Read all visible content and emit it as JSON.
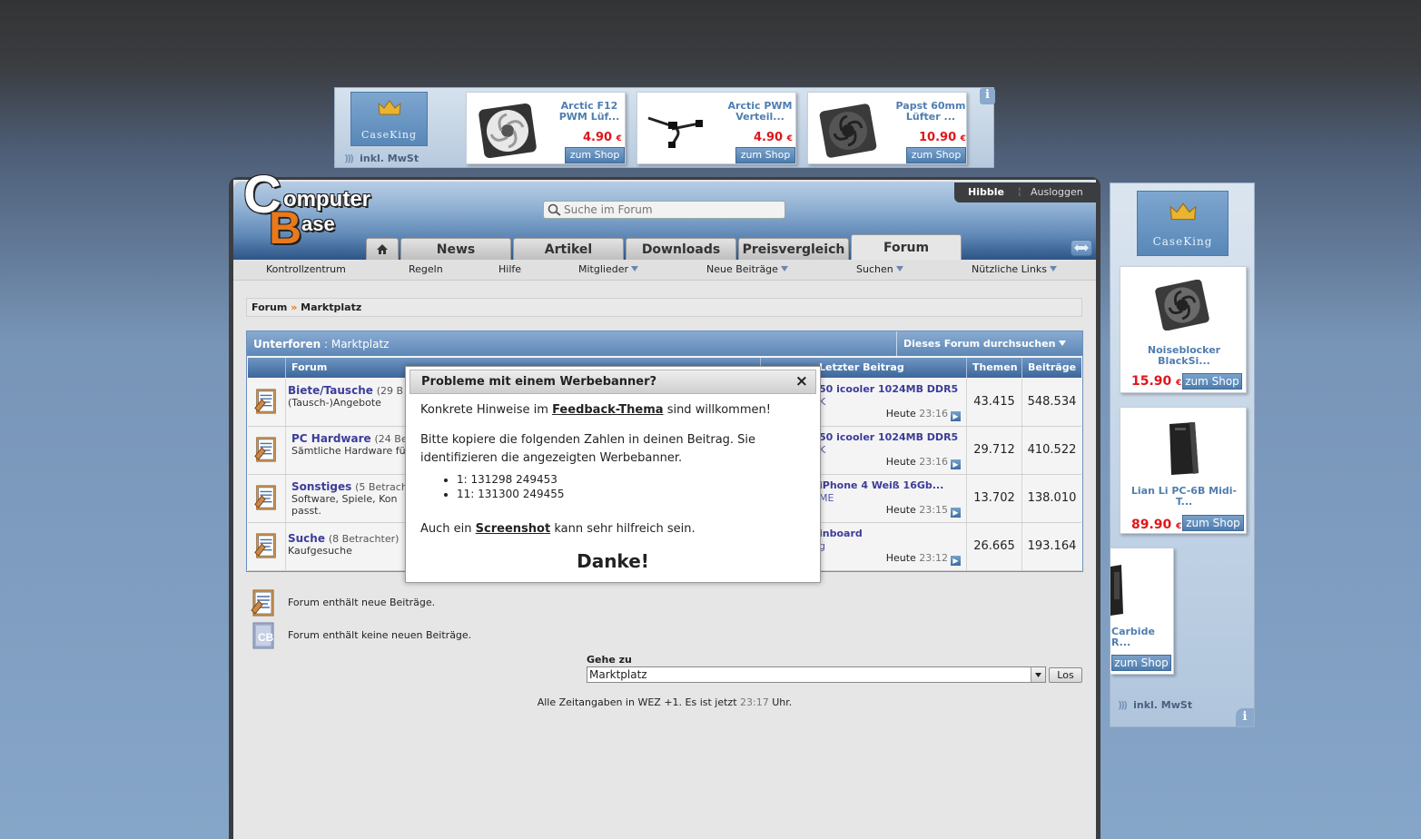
{
  "top_ad": {
    "brand": "CaseKing",
    "mwst": "inkl. MwSt",
    "info": "i",
    "products": [
      {
        "name": "Arctic F12 PWM Lüf...",
        "price": "4.90",
        "currency": "€",
        "button": "zum Shop",
        "icon": "fan-white-icon"
      },
      {
        "name": "Arctic PWM Verteil...",
        "price": "4.90",
        "currency": "€",
        "button": "zum Shop",
        "icon": "cable-icon"
      },
      {
        "name": "Papst 60mm Lüfter ...",
        "price": "10.90",
        "currency": "€",
        "button": "zum Shop",
        "icon": "fan-black-icon"
      }
    ]
  },
  "header": {
    "logo_line1": "omputer",
    "logo_line2": "ase",
    "logo_c": "C",
    "logo_b": "B",
    "search_placeholder": "Suche im Forum",
    "user": "Hibble",
    "logout": "Ausloggen"
  },
  "tabs": [
    {
      "label": "News"
    },
    {
      "label": "Artikel"
    },
    {
      "label": "Downloads"
    },
    {
      "label": "Preisvergleich"
    },
    {
      "label": "Forum"
    }
  ],
  "subnav": [
    {
      "label": "Kontrollzentrum"
    },
    {
      "label": "Regeln"
    },
    {
      "label": "Hilfe"
    },
    {
      "label": "Mitglieder"
    },
    {
      "label": "Neue Beiträge"
    },
    {
      "label": "Suchen"
    },
    {
      "label": "Nützliche Links"
    }
  ],
  "breadcrumb": {
    "root": "Forum",
    "sep": "»",
    "current": "Marktplatz"
  },
  "subforums": {
    "title": "Unterforen",
    "title_suffix": ": Marktplatz",
    "search_btn": "Dieses Forum durchsuchen",
    "columns": {
      "forum": "Forum",
      "last": "Letzter Beitrag",
      "threads": "Themen",
      "posts": "Beiträge"
    },
    "rows": [
      {
        "name": "Biete/Tausche",
        "viewers": "(29 B",
        "desc": "(Tausch-)Angebote",
        "desc2": "",
        "last_title": "50 icooler 1024MB DDR5",
        "last_user": "K",
        "time_label": "Heute",
        "time": "23:16",
        "threads": "43.415",
        "posts": "548.534"
      },
      {
        "name": "PC Hardware",
        "viewers": "(24 Be",
        "desc": "Sämtliche Hardware fü",
        "desc2": "",
        "last_title": "50 icooler 1024MB DDR5",
        "last_user": "K",
        "time_label": "Heute",
        "time": "23:16",
        "threads": "29.712",
        "posts": "410.522"
      },
      {
        "name": "Sonstiges",
        "viewers": "(5 Betrach",
        "desc": "Software, Spiele, Kon",
        "desc2": "passt.",
        "last_title": "iPhone 4 Weiß 16Gb...",
        "last_user": "ME",
        "time_label": "Heute",
        "time": "23:15",
        "threads": "13.702",
        "posts": "138.010"
      },
      {
        "name": "Suche",
        "viewers": "(8 Betrachter)",
        "desc": "Kaufgesuche",
        "desc2": "",
        "last_title": "inboard",
        "last_user": "g",
        "time_label": "Heute",
        "time": "23:12",
        "threads": "26.665",
        "posts": "193.164"
      }
    ]
  },
  "legend": {
    "new": "Forum enthält neue Beiträge.",
    "nonew": "Forum enthält keine neuen Beiträge."
  },
  "goto": {
    "label": "Gehe zu",
    "selected": "Marktplatz",
    "button": "Los"
  },
  "footer": {
    "prefix": "Alle Zeitangaben in WEZ +1. Es ist jetzt",
    "time": "23:17",
    "suffix": "Uhr."
  },
  "popup": {
    "title": "Probleme mit einem Werbebanner?",
    "close": "×",
    "p1_pre": "Konkrete Hinweise im",
    "p1_link": "Feedback-Thema",
    "p1_post": "sind willkommen!",
    "p2": "Bitte kopiere die folgenden Zahlen in deinen Beitrag. Sie identifizieren die angezeigten Werbebanner.",
    "codes": [
      "1: 131298 249453",
      "11: 131300 249455"
    ],
    "p3_pre": "Auch ein",
    "p3_link": "Screenshot",
    "p3_post": "kann sehr hilfreich sein.",
    "thanks": "Danke!"
  },
  "side_ad": {
    "brand": "CaseKing",
    "mwst": "inkl. MwSt",
    "info": "i",
    "products": [
      {
        "name": "Noiseblocker BlackSi...",
        "price": "15.90",
        "currency": "€",
        "button": "zum Shop",
        "icon": "fan-black-icon"
      },
      {
        "name": "Lian Li PC-6B Midi-T...",
        "price": "89.90",
        "currency": "€",
        "button": "zum Shop",
        "icon": "pc-case-icon"
      },
      {
        "name": "Carbide R...",
        "price": "",
        "currency": "",
        "button": "zum Shop",
        "icon": "pc-case-icon"
      }
    ]
  },
  "colors": {
    "link": "#3c3c9a",
    "price": "#e0161b",
    "accent": "#5e87b6",
    "orange": "#e87a1c"
  }
}
